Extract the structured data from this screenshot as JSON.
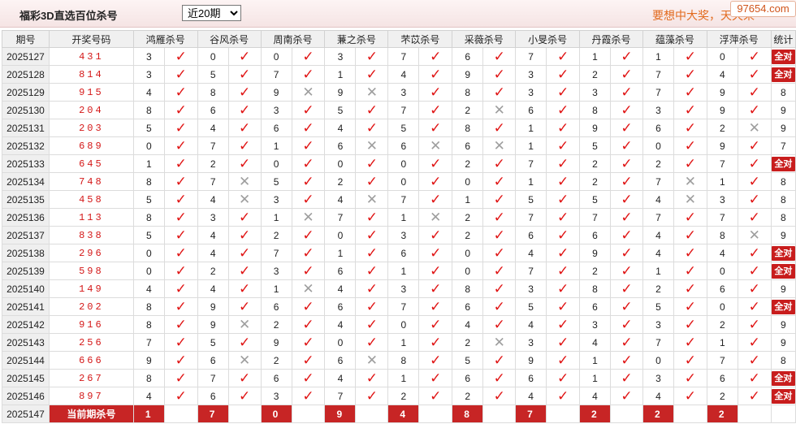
{
  "header": {
    "title": "福彩3D直选百位杀号",
    "range_selected": "近20期",
    "slogan": "要想中大奖，天天来",
    "watermark": "97654.com"
  },
  "colors": {
    "accent_red": "#c72525",
    "hit_red": "#e01414",
    "miss_gray": "#9e9e9e",
    "slogan_orange": "#e26a1e"
  },
  "table": {
    "columns": [
      "期号",
      "开奖号码",
      "鸿雁杀号",
      "谷风杀号",
      "周南杀号",
      "蒹之杀号",
      "芣苡杀号",
      "采薇杀号",
      "小旻杀号",
      "丹霞杀号",
      "蕴藻杀号",
      "浮萍杀号",
      "统计"
    ],
    "rows": [
      {
        "issue": "2025127",
        "draw": "431",
        "kills": [
          "3",
          "0",
          "0",
          "3",
          "7",
          "6",
          "7",
          "1",
          "1",
          "0"
        ],
        "results": [
          "ok",
          "ok",
          "ok",
          "ok",
          "ok",
          "ok",
          "ok",
          "ok",
          "ok",
          "ok"
        ],
        "stat": "全对"
      },
      {
        "issue": "2025128",
        "draw": "814",
        "kills": [
          "3",
          "5",
          "7",
          "1",
          "4",
          "9",
          "3",
          "2",
          "7",
          "4"
        ],
        "results": [
          "ok",
          "ok",
          "ok",
          "ok",
          "ok",
          "ok",
          "ok",
          "ok",
          "ok",
          "ok"
        ],
        "stat": "全对"
      },
      {
        "issue": "2025129",
        "draw": "915",
        "kills": [
          "4",
          "8",
          "9",
          "9",
          "3",
          "8",
          "3",
          "3",
          "7",
          "9"
        ],
        "results": [
          "ok",
          "ok",
          "bad",
          "bad",
          "ok",
          "ok",
          "ok",
          "ok",
          "ok",
          "ok"
        ],
        "stat": "8"
      },
      {
        "issue": "2025130",
        "draw": "204",
        "kills": [
          "8",
          "6",
          "3",
          "5",
          "7",
          "2",
          "6",
          "8",
          "3",
          "9"
        ],
        "results": [
          "ok",
          "ok",
          "ok",
          "ok",
          "ok",
          "bad",
          "ok",
          "ok",
          "ok",
          "ok"
        ],
        "stat": "9"
      },
      {
        "issue": "2025131",
        "draw": "203",
        "kills": [
          "5",
          "4",
          "6",
          "4",
          "5",
          "8",
          "1",
          "9",
          "6",
          "2"
        ],
        "results": [
          "ok",
          "ok",
          "ok",
          "ok",
          "ok",
          "ok",
          "ok",
          "ok",
          "ok",
          "bad"
        ],
        "stat": "9"
      },
      {
        "issue": "2025132",
        "draw": "689",
        "kills": [
          "0",
          "7",
          "1",
          "6",
          "6",
          "6",
          "1",
          "5",
          "0",
          "9"
        ],
        "results": [
          "ok",
          "ok",
          "ok",
          "bad",
          "bad",
          "bad",
          "ok",
          "ok",
          "ok",
          "ok"
        ],
        "stat": "7"
      },
      {
        "issue": "2025133",
        "draw": "645",
        "kills": [
          "1",
          "2",
          "0",
          "0",
          "0",
          "2",
          "7",
          "2",
          "2",
          "7"
        ],
        "results": [
          "ok",
          "ok",
          "ok",
          "ok",
          "ok",
          "ok",
          "ok",
          "ok",
          "ok",
          "ok"
        ],
        "stat": "全对"
      },
      {
        "issue": "2025134",
        "draw": "748",
        "kills": [
          "8",
          "7",
          "5",
          "2",
          "0",
          "0",
          "1",
          "2",
          "7",
          "1"
        ],
        "results": [
          "ok",
          "bad",
          "ok",
          "ok",
          "ok",
          "ok",
          "ok",
          "ok",
          "bad",
          "ok"
        ],
        "stat": "8"
      },
      {
        "issue": "2025135",
        "draw": "458",
        "kills": [
          "5",
          "4",
          "3",
          "4",
          "7",
          "1",
          "5",
          "5",
          "4",
          "3"
        ],
        "results": [
          "ok",
          "bad",
          "ok",
          "bad",
          "ok",
          "ok",
          "ok",
          "ok",
          "bad",
          "ok"
        ],
        "stat": "8"
      },
      {
        "issue": "2025136",
        "draw": "113",
        "kills": [
          "8",
          "3",
          "1",
          "7",
          "1",
          "2",
          "7",
          "7",
          "7",
          "7"
        ],
        "results": [
          "ok",
          "ok",
          "bad",
          "ok",
          "bad",
          "ok",
          "ok",
          "ok",
          "ok",
          "ok"
        ],
        "stat": "8"
      },
      {
        "issue": "2025137",
        "draw": "838",
        "kills": [
          "5",
          "4",
          "2",
          "0",
          "3",
          "2",
          "6",
          "6",
          "4",
          "8"
        ],
        "results": [
          "ok",
          "ok",
          "ok",
          "ok",
          "ok",
          "ok",
          "ok",
          "ok",
          "ok",
          "bad"
        ],
        "stat": "9"
      },
      {
        "issue": "2025138",
        "draw": "296",
        "kills": [
          "0",
          "4",
          "7",
          "1",
          "6",
          "0",
          "4",
          "9",
          "4",
          "4"
        ],
        "results": [
          "ok",
          "ok",
          "ok",
          "ok",
          "ok",
          "ok",
          "ok",
          "ok",
          "ok",
          "ok"
        ],
        "stat": "全对"
      },
      {
        "issue": "2025139",
        "draw": "598",
        "kills": [
          "0",
          "2",
          "3",
          "6",
          "1",
          "0",
          "7",
          "2",
          "1",
          "0"
        ],
        "results": [
          "ok",
          "ok",
          "ok",
          "ok",
          "ok",
          "ok",
          "ok",
          "ok",
          "ok",
          "ok"
        ],
        "stat": "全对"
      },
      {
        "issue": "2025140",
        "draw": "149",
        "kills": [
          "4",
          "4",
          "1",
          "4",
          "3",
          "8",
          "3",
          "8",
          "2",
          "6"
        ],
        "results": [
          "ok",
          "ok",
          "bad",
          "ok",
          "ok",
          "ok",
          "ok",
          "ok",
          "ok",
          "ok"
        ],
        "stat": "9"
      },
      {
        "issue": "2025141",
        "draw": "202",
        "kills": [
          "8",
          "9",
          "6",
          "6",
          "7",
          "6",
          "5",
          "6",
          "5",
          "0"
        ],
        "results": [
          "ok",
          "ok",
          "ok",
          "ok",
          "ok",
          "ok",
          "ok",
          "ok",
          "ok",
          "ok"
        ],
        "stat": "全对"
      },
      {
        "issue": "2025142",
        "draw": "916",
        "kills": [
          "8",
          "9",
          "2",
          "4",
          "0",
          "4",
          "4",
          "3",
          "3",
          "2"
        ],
        "results": [
          "ok",
          "bad",
          "ok",
          "ok",
          "ok",
          "ok",
          "ok",
          "ok",
          "ok",
          "ok"
        ],
        "stat": "9"
      },
      {
        "issue": "2025143",
        "draw": "256",
        "kills": [
          "7",
          "5",
          "9",
          "0",
          "1",
          "2",
          "3",
          "4",
          "7",
          "1"
        ],
        "results": [
          "ok",
          "ok",
          "ok",
          "ok",
          "ok",
          "bad",
          "ok",
          "ok",
          "ok",
          "ok"
        ],
        "stat": "9"
      },
      {
        "issue": "2025144",
        "draw": "666",
        "kills": [
          "9",
          "6",
          "2",
          "6",
          "8",
          "5",
          "9",
          "1",
          "0",
          "7"
        ],
        "results": [
          "ok",
          "bad",
          "ok",
          "bad",
          "ok",
          "ok",
          "ok",
          "ok",
          "ok",
          "ok"
        ],
        "stat": "8"
      },
      {
        "issue": "2025145",
        "draw": "267",
        "kills": [
          "8",
          "7",
          "6",
          "4",
          "1",
          "6",
          "6",
          "1",
          "3",
          "6"
        ],
        "results": [
          "ok",
          "ok",
          "ok",
          "ok",
          "ok",
          "ok",
          "ok",
          "ok",
          "ok",
          "ok"
        ],
        "stat": "全对"
      },
      {
        "issue": "2025146",
        "draw": "897",
        "kills": [
          "4",
          "6",
          "3",
          "7",
          "2",
          "2",
          "4",
          "4",
          "4",
          "2"
        ],
        "results": [
          "ok",
          "ok",
          "ok",
          "ok",
          "ok",
          "ok",
          "ok",
          "ok",
          "ok",
          "ok"
        ],
        "stat": "全对"
      }
    ],
    "current": {
      "issue": "2025147",
      "label": "当前期杀号",
      "kills": [
        "1",
        "7",
        "0",
        "9",
        "4",
        "8",
        "7",
        "2",
        "2",
        "2"
      ]
    }
  }
}
